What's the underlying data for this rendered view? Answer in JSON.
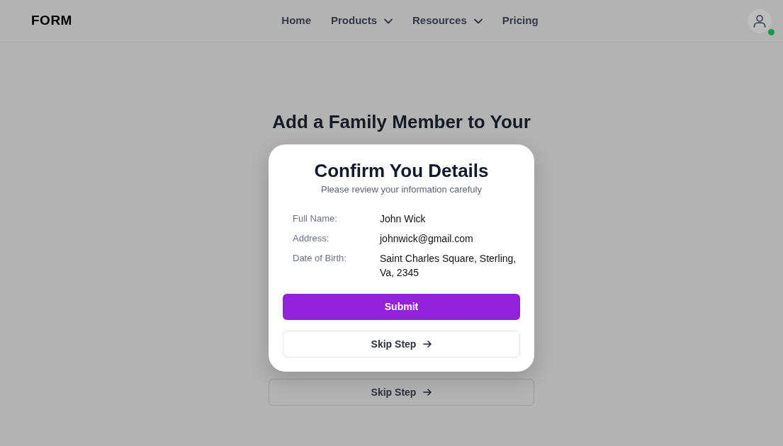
{
  "header": {
    "logo": "FORM",
    "nav": [
      {
        "label": "Home",
        "has_menu": false
      },
      {
        "label": "Products",
        "has_menu": true
      },
      {
        "label": "Resources",
        "has_menu": true
      },
      {
        "label": "Pricing",
        "has_menu": false
      }
    ],
    "user": {
      "online": true
    }
  },
  "page": {
    "heading": "Add a Family Member to Your",
    "skip_button": "Skip Step"
  },
  "modal": {
    "title": "Confirm You Details",
    "subtitle": "Please review your information carefuly",
    "details": [
      {
        "label": "Full Name:",
        "value": "John Wick"
      },
      {
        "label": "Address:",
        "value": "johnwick@gmail.com"
      },
      {
        "label": "Date of Birth:",
        "value": "Saint Charles Square, Sterling, Va, 2345"
      }
    ],
    "submit_button": "Submit",
    "skip_button": "Skip Step"
  }
}
